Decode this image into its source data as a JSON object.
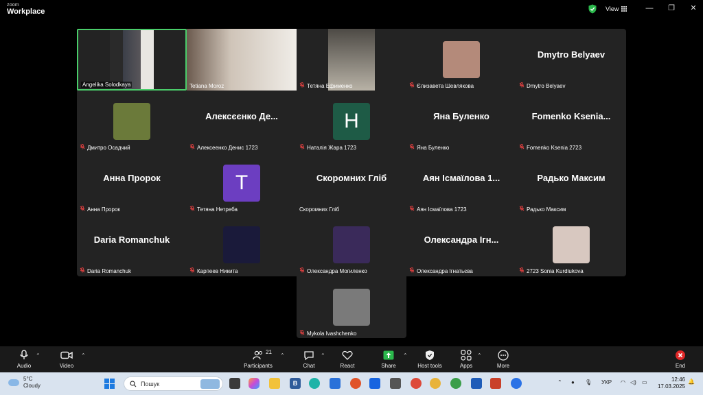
{
  "titlebar": {
    "logo_line1": "zoom",
    "logo_line2": "Workplace",
    "view_label": "View"
  },
  "gallery": {
    "tiles": [
      {
        "label": "Angelika Solodkaya",
        "video": true,
        "muted": false,
        "active": true
      },
      {
        "label": "Tetiana Moroz",
        "video": true,
        "muted": false
      },
      {
        "label": "Тетяна Ефименко",
        "video": true,
        "muted": true
      },
      {
        "label": "Єлизавета Шевлякова",
        "avatar": "photo",
        "muted": true
      },
      {
        "label": "Dmytro Belyaev",
        "big_name": "Dmytro Belyaev",
        "muted": true
      },
      {
        "label": "Дмитро Осадчий",
        "avatar": "photo",
        "muted": true
      },
      {
        "label": "Алексеенко Денис 1723",
        "big_name": "Алексєєнко Де...",
        "muted": true
      },
      {
        "label": "Наталія Жара 1723",
        "avatar": "letter",
        "letter": "H",
        "muted": true
      },
      {
        "label": "Яна Буленко",
        "big_name": "Яна Буленко",
        "muted": true
      },
      {
        "label": "Fomenko Ksenia 2723",
        "big_name": "Fomenko  Ksenia...",
        "muted": true
      },
      {
        "label": "Анна Пророк",
        "big_name": "Анна Пророк",
        "muted": true
      },
      {
        "label": "Тетяна Нетреба",
        "avatar": "letter",
        "letter": "T",
        "muted": true
      },
      {
        "label": "Скоромних Гліб",
        "big_name": "Скоромних Гліб",
        "muted": false
      },
      {
        "label": "Аян Ісмаїлова 1723",
        "big_name": "Аян Ісмаїлова  1...",
        "muted": true
      },
      {
        "label": "Радько Максим",
        "big_name": "Радько Максим",
        "muted": true
      },
      {
        "label": "Daria Romanchuk",
        "big_name": "Daria Romanchuk",
        "muted": true
      },
      {
        "label": "Карпеев Никита",
        "avatar": "photo",
        "muted": true
      },
      {
        "label": "Олександра Могиленко",
        "avatar": "photo",
        "muted": true
      },
      {
        "label": "Олександра Ігнатьєва",
        "big_name": "Олександра Ігн...",
        "muted": true
      },
      {
        "label": "2723 Sonia Kurdiukova",
        "avatar": "photo",
        "muted": true
      },
      {
        "label": "Mykola Ivashchenko",
        "avatar": "photo",
        "muted": true
      }
    ]
  },
  "toolbar": {
    "audio": "Audio",
    "video": "Video",
    "participants": "Participants",
    "participants_count": "21",
    "chat": "Chat",
    "react": "React",
    "share": "Share",
    "host_tools": "Host tools",
    "apps": "Apps",
    "more": "More",
    "end": "End"
  },
  "taskbar": {
    "temperature": "5°C",
    "weather": "Cloudy",
    "search_placeholder": "Пошук",
    "language": "УКР",
    "time": "12:46",
    "date": "17.03.2025"
  },
  "colors": {
    "active_speaker_border": "#4acd6a",
    "end_button": "#e02828",
    "share_icon": "#2bb84c",
    "letter_H_bg": "#1e5b46",
    "letter_T_bg": "#6c3ec1"
  }
}
